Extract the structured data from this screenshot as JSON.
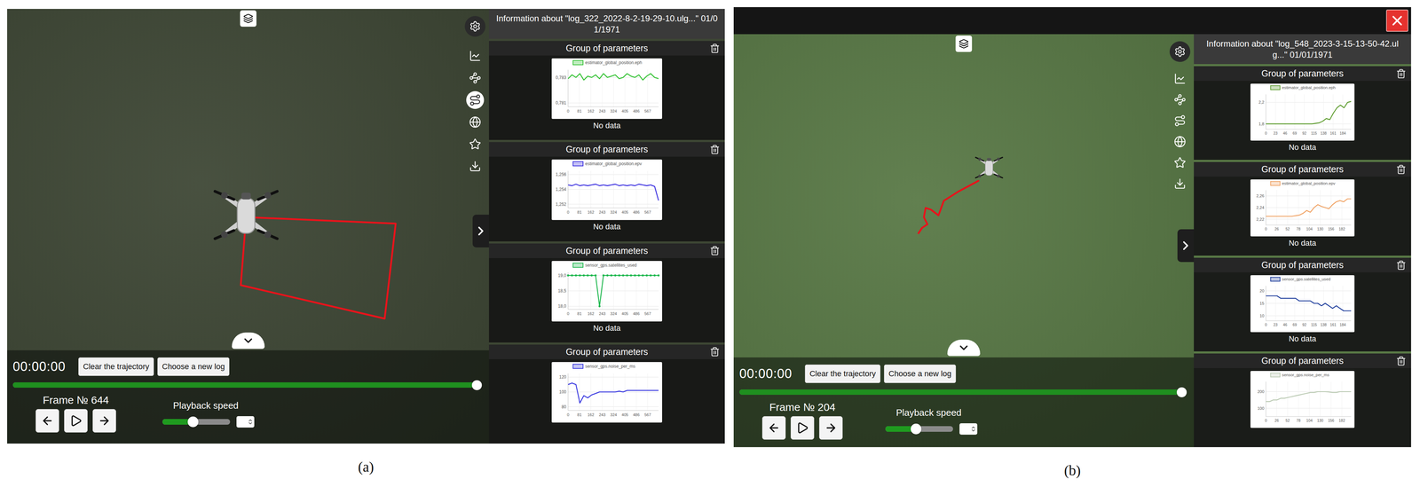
{
  "panels": [
    {
      "caption": "(a)",
      "close_button": false,
      "info_header": "Information about \"log_322_2022-8-2-19-29-10.ulg...\" 01/01/1971",
      "toolbar": [
        {
          "selected": false
        },
        {
          "selected": false
        },
        {
          "selected": true
        },
        {
          "selected": false
        },
        {
          "selected": false
        },
        {
          "selected": false
        }
      ],
      "groups": [
        {
          "title": "Group of parameters",
          "series_label": "estimator_global_position.eph",
          "color": "#33c233",
          "y_ticks": [
            "0,783",
            "0,781"
          ],
          "y_range": [
            0.7807,
            0.7836
          ],
          "x_ticks": [
            "0",
            "81",
            "162",
            "243",
            "324",
            "405",
            "486",
            "567"
          ],
          "x_range": [
            0,
            644
          ],
          "markers": false,
          "values": [
            0.7829,
            0.7832,
            0.783,
            0.7833,
            0.7828,
            0.7831,
            0.783,
            0.7832,
            0.7829,
            0.7833,
            0.783,
            0.7831,
            0.7832,
            0.7829,
            0.783,
            0.7833,
            0.7831,
            0.783,
            0.7832,
            0.7828,
            0.7831,
            0.7833,
            0.783,
            0.7829
          ],
          "footer": "No data"
        },
        {
          "title": "Group of parameters",
          "series_label": "estimator_global_position.epv",
          "color": "#3a2ee0",
          "y_ticks": [
            "1,256",
            "1,254",
            "1,252"
          ],
          "y_range": [
            1.2515,
            1.2565
          ],
          "x_ticks": [
            "0",
            "81",
            "162",
            "243",
            "324",
            "405",
            "486",
            "567"
          ],
          "x_range": [
            0,
            644
          ],
          "markers": false,
          "values": [
            1.2546,
            1.2545,
            1.2547,
            1.2545,
            1.2546,
            1.2545,
            1.2546,
            1.2547,
            1.2545,
            1.2546,
            1.2545,
            1.2546,
            1.2547,
            1.2545,
            1.2546,
            1.2545,
            1.2546,
            1.2545,
            1.2547,
            1.2546,
            1.2545,
            1.2546,
            1.2544,
            1.2525
          ],
          "footer": "No data"
        },
        {
          "title": "Group of parameters",
          "series_label": "sensor_gps.satellites_used",
          "color": "#1fb84f",
          "y_ticks": [
            "19,0",
            "18,5",
            "18,0"
          ],
          "y_range": [
            17.9,
            19.1
          ],
          "x_ticks": [
            "0",
            "81",
            "162",
            "243",
            "324",
            "405",
            "486",
            "567"
          ],
          "x_range": [
            0,
            644
          ],
          "markers": true,
          "values": [
            19,
            19,
            19,
            19,
            19,
            19,
            19,
            19,
            18,
            19,
            19,
            19,
            19,
            19,
            19,
            19,
            19,
            19,
            19,
            19,
            19,
            19,
            19,
            19
          ],
          "footer": "No data"
        },
        {
          "title": "Group of parameters",
          "series_label": "sensor_gps.noise_per_ms",
          "color": "#3a3ae0",
          "y_ticks": [
            "120",
            "100",
            "80"
          ],
          "y_range": [
            75,
            125
          ],
          "x_ticks": [
            "0",
            "81",
            "162",
            "243",
            "324",
            "405",
            "486",
            "567"
          ],
          "x_range": [
            0,
            644
          ],
          "markers": false,
          "values": [
            110,
            112,
            110,
            85,
            95,
            92,
            96,
            98,
            100,
            100,
            100,
            100,
            100,
            101,
            100,
            102,
            102,
            102,
            102,
            102,
            102,
            102,
            102,
            102
          ]
        }
      ],
      "player": {
        "time": "00:00:00",
        "buttons": [
          "Clear the trajectory",
          "Choose a new log"
        ],
        "progress": 1.0,
        "frame": "Frame № 644",
        "speed_label": "Playback speed",
        "speed": 0.45
      }
    },
    {
      "caption": "(b)",
      "close_button": true,
      "info_header": "Information about \"log_548_2023-3-15-13-50-42.ulg...\" 01/01/1971",
      "toolbar": [
        {
          "selected": false
        },
        {
          "selected": false
        },
        {
          "selected": false
        },
        {
          "selected": false
        },
        {
          "selected": false
        },
        {
          "selected": false
        }
      ],
      "groups": [
        {
          "title": "Group of parameters",
          "series_label": "estimator_global_position.eph",
          "color": "#5a9a2a",
          "y_ticks": [
            "2,2",
            "1,8"
          ],
          "y_range": [
            1.7,
            2.35
          ],
          "x_ticks": [
            "0",
            "23",
            "46",
            "69",
            "92",
            "115",
            "138",
            "161",
            "184"
          ],
          "x_range": [
            0,
            204
          ],
          "markers": false,
          "values": [
            1.8,
            1.8,
            1.8,
            1.8,
            1.8,
            1.8,
            1.8,
            1.8,
            1.8,
            1.8,
            1.8,
            1.8,
            1.8,
            1.8,
            1.81,
            1.82,
            1.85,
            1.9,
            1.88,
            2.0,
            2.1,
            2.15,
            2.1,
            2.2,
            2.22
          ],
          "footer": "No data"
        },
        {
          "title": "Group of parameters",
          "series_label": "estimator_global_position.epv",
          "color": "#f0a060",
          "y_ticks": [
            "2,26",
            "2,24",
            "2,22"
          ],
          "y_range": [
            2.21,
            2.27
          ],
          "x_ticks": [
            "0",
            "26",
            "52",
            "78",
            "104",
            "130",
            "156",
            "182"
          ],
          "x_range": [
            0,
            204
          ],
          "markers": false,
          "values": [
            2.225,
            2.225,
            2.225,
            2.225,
            2.225,
            2.225,
            2.225,
            2.225,
            2.226,
            2.227,
            2.23,
            2.235,
            2.232,
            2.24,
            2.245,
            2.242,
            2.24,
            2.238,
            2.245,
            2.25,
            2.252,
            2.25,
            2.255,
            2.255
          ],
          "footer": "No data"
        },
        {
          "title": "Group of parameters",
          "series_label": "sensor_gps.satellites_used",
          "color": "#1a3a9a",
          "y_ticks": [
            "20",
            "15",
            "10"
          ],
          "y_range": [
            8,
            22
          ],
          "x_ticks": [
            "0",
            "23",
            "46",
            "69",
            "92",
            "115",
            "138",
            "161",
            "184"
          ],
          "x_range": [
            0,
            204
          ],
          "markers": false,
          "values": [
            18,
            18,
            18,
            18,
            17,
            17,
            17,
            17,
            17,
            16,
            16,
            16,
            16,
            15,
            15,
            14,
            15,
            14,
            13,
            14,
            13,
            12,
            12,
            12
          ],
          "footer": "No data"
        },
        {
          "title": "Group of parameters",
          "series_label": "sensor_gps.noise_per_ms",
          "color": "#b8c8b0",
          "y_ticks": [
            "200",
            "100"
          ],
          "y_range": [
            50,
            260
          ],
          "x_ticks": [
            "0",
            "26",
            "52",
            "78",
            "104",
            "130",
            "156",
            "182"
          ],
          "x_range": [
            0,
            204
          ],
          "markers": false,
          "values": [
            140,
            140,
            150,
            150,
            160,
            160,
            165,
            170,
            175,
            180,
            185,
            190,
            195,
            195,
            200,
            200,
            200,
            198,
            195,
            195,
            200,
            200,
            200,
            200
          ]
        }
      ],
      "player": {
        "time": "00:00:00",
        "buttons": [
          "Clear the trajectory",
          "Choose a new log"
        ],
        "progress": 1.0,
        "frame": "Frame № 204",
        "speed_label": "Playback speed",
        "speed": 0.45
      }
    }
  ]
}
